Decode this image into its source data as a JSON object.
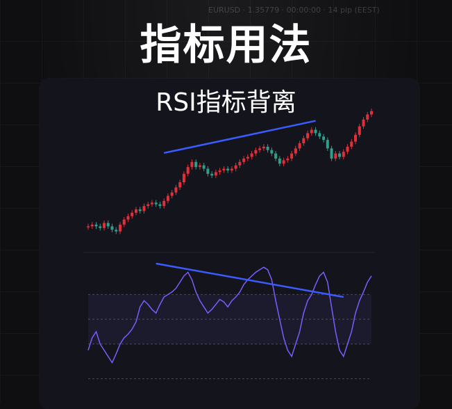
{
  "header": {
    "title": "指标用法",
    "background_text": "EURUSD · 1.35779 · 00:00:00 · 14 pip (EEST)"
  },
  "panel": {
    "title": "RSI指标背离"
  },
  "colors": {
    "bull": "#e0303a",
    "bear": "#2f9e8a",
    "trendline": "#3b5bff",
    "rsi_line": "#7b5cff",
    "rsi_band": "#1c1b2e"
  },
  "chart_data": [
    {
      "type": "candlestick",
      "closes": [
        1.0,
        1.1,
        1.0,
        0.9,
        1.2,
        1.0,
        0.8,
        0.7,
        1.1,
        1.4,
        1.6,
        1.8,
        2.0,
        1.9,
        2.2,
        2.3,
        2.4,
        2.3,
        2.2,
        2.5,
        2.8,
        3.0,
        3.3,
        3.6,
        4.1,
        4.5,
        4.8,
        4.5,
        4.6,
        4.4,
        4.1,
        4.0,
        4.2,
        4.3,
        4.4,
        4.3,
        4.4,
        4.6,
        4.8,
        5.0,
        5.1,
        5.3,
        5.5,
        5.6,
        5.7,
        5.5,
        5.3,
        5.0,
        4.7,
        4.9,
        5.0,
        5.3,
        5.6,
        5.9,
        6.2,
        6.5,
        6.7,
        6.5,
        6.3,
        6.1,
        5.6,
        5.0,
        5.3,
        5.1,
        5.4,
        5.7,
        6.0,
        6.4,
        6.9,
        7.3,
        7.6,
        7.8
      ],
      "trendline": {
        "from": [
          19,
          5.0
        ],
        "to": [
          57,
          6.9
        ]
      }
    },
    {
      "type": "line",
      "name": "",
      "values": [
        25,
        35,
        40,
        30,
        25,
        20,
        15,
        22,
        30,
        35,
        38,
        42,
        48,
        60,
        65,
        62,
        58,
        55,
        62,
        68,
        70,
        72,
        75,
        80,
        85,
        88,
        82,
        72,
        65,
        60,
        55,
        58,
        62,
        66,
        64,
        60,
        65,
        68,
        72,
        78,
        82,
        85,
        88,
        90,
        92,
        90,
        82,
        65,
        50,
        35,
        25,
        20,
        30,
        40,
        55,
        65,
        70,
        78,
        85,
        88,
        80,
        60,
        40,
        25,
        20,
        30,
        40,
        55,
        65,
        72,
        80,
        85
      ],
      "ylim": [
        0,
        100
      ],
      "overbought": 70,
      "oversold": 30,
      "trendline": {
        "from": [
          17,
          95
        ],
        "to": [
          64,
          68
        ]
      }
    }
  ]
}
